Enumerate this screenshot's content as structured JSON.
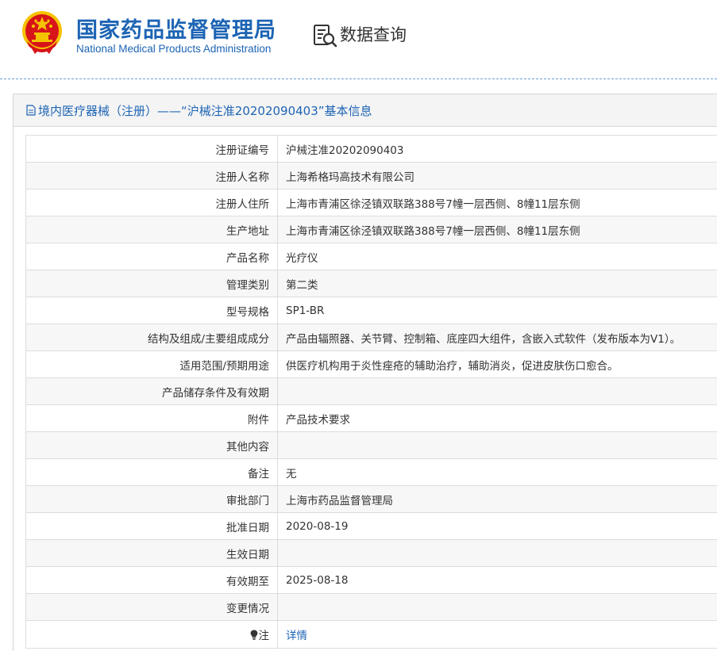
{
  "header": {
    "title_cn": "国家药品监督管理局",
    "title_en": "National Medical Products Administration",
    "query_label": "数据查询",
    "emblem_icon": "national-emblem-icon",
    "query_icon": "data-query-icon"
  },
  "panel": {
    "title": "境内医疗器械（注册）——“沪械注准20202090403”基本信息"
  },
  "fields": [
    {
      "label": "注册证编号",
      "value": "沪械注准20202090403"
    },
    {
      "label": "注册人名称",
      "value": "上海希格玛高技术有限公司"
    },
    {
      "label": "注册人住所",
      "value": "上海市青浦区徐泾镇双联路388号7幢一层西侧、8幢11层东侧"
    },
    {
      "label": "生产地址",
      "value": "上海市青浦区徐泾镇双联路388号7幢一层西侧、8幢11层东侧"
    },
    {
      "label": "产品名称",
      "value": "光疗仪"
    },
    {
      "label": "管理类别",
      "value": "第二类"
    },
    {
      "label": "型号规格",
      "value": "SP1-BR"
    },
    {
      "label": "结构及组成/主要组成成分",
      "value": "产品由辐照器、关节臂、控制箱、底座四大组件，含嵌入式软件（发布版本为V1）。"
    },
    {
      "label": "适用范围/预期用途",
      "value": "供医疗机构用于炎性痤疮的辅助治疗，辅助消炎，促进皮肤伤口愈合。"
    },
    {
      "label": "产品储存条件及有效期",
      "value": ""
    },
    {
      "label": "附件",
      "value": "产品技术要求"
    },
    {
      "label": "其他内容",
      "value": ""
    },
    {
      "label": "备注",
      "value": "无"
    },
    {
      "label": "审批部门",
      "value": "上海市药品监督管理局"
    },
    {
      "label": "批准日期",
      "value": "2020-08-19"
    },
    {
      "label": "生效日期",
      "value": ""
    },
    {
      "label": "有效期至",
      "value": "2025-08-18"
    },
    {
      "label": "变更情况",
      "value": ""
    }
  ],
  "note": {
    "label": "注",
    "link_text": "详情",
    "icon": "lightbulb-icon"
  },
  "colors": {
    "brand_blue": "#1d64b4",
    "emblem_red": "#d7141a",
    "emblem_gold": "#f5c200"
  }
}
